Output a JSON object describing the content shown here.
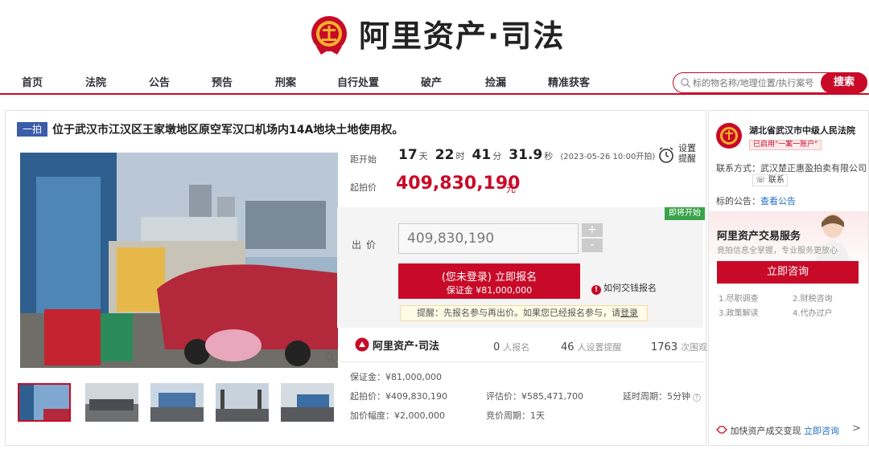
{
  "header": {
    "brand_title": "阿里资产·司法"
  },
  "nav": {
    "items": [
      "首页",
      "法院",
      "公告",
      "预告",
      "刑案",
      "自行处置",
      "破产",
      "捡漏",
      "精准获客"
    ],
    "search_placeholder": "标的物名称/地理位置/执行案号",
    "search_button": "搜索"
  },
  "auction": {
    "round_badge": "一拍",
    "title": "位于武汉市江汉区王家墩地区原空军汉口机场内14A地块土地使用权。",
    "countdown": {
      "label": "距开始",
      "days": "17",
      "days_unit": "天",
      "hours": "22",
      "hours_unit": "时",
      "minutes": "41",
      "minutes_unit": "分",
      "seconds": "31.9",
      "seconds_unit": "秒",
      "start_time": "(2023-05-26 10:00开拍)"
    },
    "remind": "设置提醒",
    "start_price_label": "起拍价",
    "start_price": "409,830,190",
    "start_price_unit": "元",
    "soon_badge": "即将开始",
    "bid_label": "出价",
    "bid_value": "409,830,190",
    "stepper_plus": "+",
    "stepper_minus": "-",
    "register_main": "(您未登录) 立即报名",
    "register_deposit": "保证金 ¥81,000,000",
    "how_pay": "如何交钱报名",
    "how_pay_icon": "!",
    "reminder_text": "提醒：先报名参与再出价。如果您已经报名参与，请",
    "reminder_link": "登录",
    "stats": {
      "brand": "阿里资产·司法",
      "signups": "0",
      "signups_label": "人报名",
      "reminders": "46",
      "reminders_label": "人设置提醒",
      "views": "1763",
      "views_label": "次围观"
    },
    "details": {
      "deposit": "保证金：¥81,000,000",
      "start_price": "起拍价：¥409,830,190",
      "appraisal": "评估价：¥585,471,700",
      "delay": "延时周期：5分钟",
      "increment": "加价幅度：¥2,000,000",
      "cycle": "竞价周期：1天"
    }
  },
  "sidebar": {
    "court_name": "湖北省武汉市中级人民法院",
    "court_tag": "已启用\"一案一账户\"",
    "contact_label": "联系方式：武汉楚正惠盈拍卖有限公司",
    "contact_button": "联系",
    "announce_label": "标的公告：",
    "announce_link": "查看公告",
    "service_title": "阿里资产交易服务",
    "service_sub": "竟拍信息全掌握，专业服务更放心",
    "consult_button": "立即咨询",
    "service_items": [
      "1.尽职调查",
      "2.财税咨询",
      "3.政策解读",
      "4.代办过户"
    ],
    "footer_text": "加快资产成交变现",
    "footer_link": "立即咨询",
    "footer_arrow": ">"
  },
  "colors": {
    "brand_red": "#c80a28",
    "badge_blue": "#3a5daa",
    "soon_green": "#3aa34a"
  }
}
